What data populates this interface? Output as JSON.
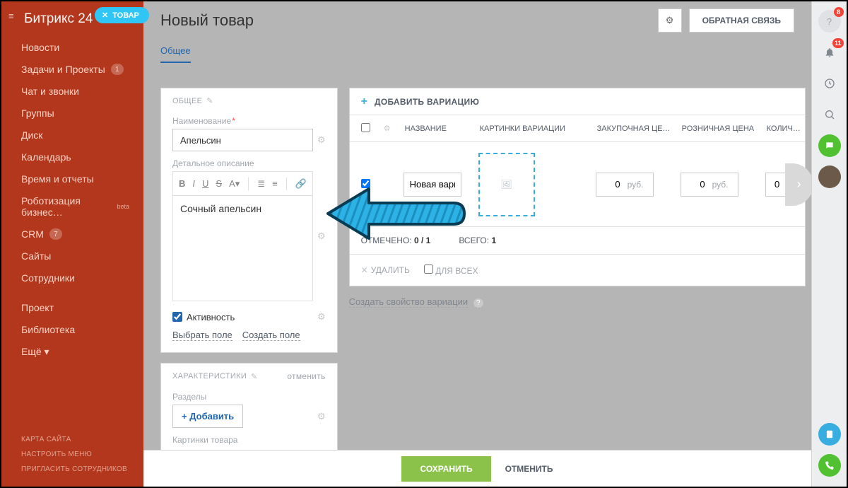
{
  "brand": "Битрикс 24",
  "top_pill": {
    "label": "ТОВАР"
  },
  "rightbar": {
    "help_badge": "8",
    "bell_badge": "11"
  },
  "left_nav": {
    "items": [
      {
        "label": "Новости"
      },
      {
        "label": "Задачи и Проекты",
        "count": "1"
      },
      {
        "label": "Чат и звонки"
      },
      {
        "label": "Группы"
      },
      {
        "label": "Диск"
      },
      {
        "label": "Календарь"
      },
      {
        "label": "Время и отчеты"
      },
      {
        "label": "Роботизация бизнес…",
        "beta": "beta"
      },
      {
        "label": "CRM",
        "count": "7"
      },
      {
        "label": "Сайты"
      },
      {
        "label": "Сотрудники"
      }
    ],
    "items2": [
      {
        "label": "Проект"
      },
      {
        "label": "Библиотека"
      },
      {
        "label": "Ещё ▾"
      }
    ],
    "bottom": [
      "КАРТА САЙТА",
      "НАСТРОИТЬ МЕНЮ",
      "ПРИГЛАСИТЬ СОТРУДНИКОВ"
    ]
  },
  "page": {
    "title": "Новый товар",
    "feedback": "ОБРАТНАЯ СВЯЗЬ",
    "tab_general": "Общее"
  },
  "general_card": {
    "heading": "ОБЩЕЕ",
    "name_label": "Наименование",
    "name_value": "Апельсин",
    "desc_label": "Детальное описание",
    "desc_value": "Сочный апельсин",
    "activity_label": "Активность",
    "select_field": "Выбрать поле",
    "create_field": "Создать поле"
  },
  "chars_card": {
    "heading": "ХАРАКТЕРИСТИКИ",
    "cancel": "отменить",
    "sections_label": "Разделы",
    "add": "+ Добавить",
    "images_label": "Картинки товара"
  },
  "variation": {
    "add_variation": "ДОБАВИТЬ ВАРИАЦИЮ",
    "col_name": "НАЗВАНИЕ",
    "col_img": "КАРТИНКИ ВАРИАЦИИ",
    "col_purchase": "ЗАКУПОЧНАЯ ЦЕ…",
    "col_retail": "РОЗНИЧНАЯ ЦЕНА",
    "col_qty": "КОЛИЧ…",
    "row": {
      "name_value": "Новая вариа",
      "purchase_value": "0",
      "retail_value": "0",
      "qty_value": "0",
      "currency": "руб."
    },
    "selected_label": "ОТМЕЧЕНО:",
    "selected_value": "0 / 1",
    "total_label": "ВСЕГО:",
    "total_value": "1",
    "delete": "УДАЛИТЬ",
    "for_all": "ДЛЯ ВСЕХ",
    "create_prop": "Создать свойство вариации"
  },
  "footer": {
    "save": "СОХРАНИТЬ",
    "cancel": "ОТМЕНИТЬ"
  }
}
